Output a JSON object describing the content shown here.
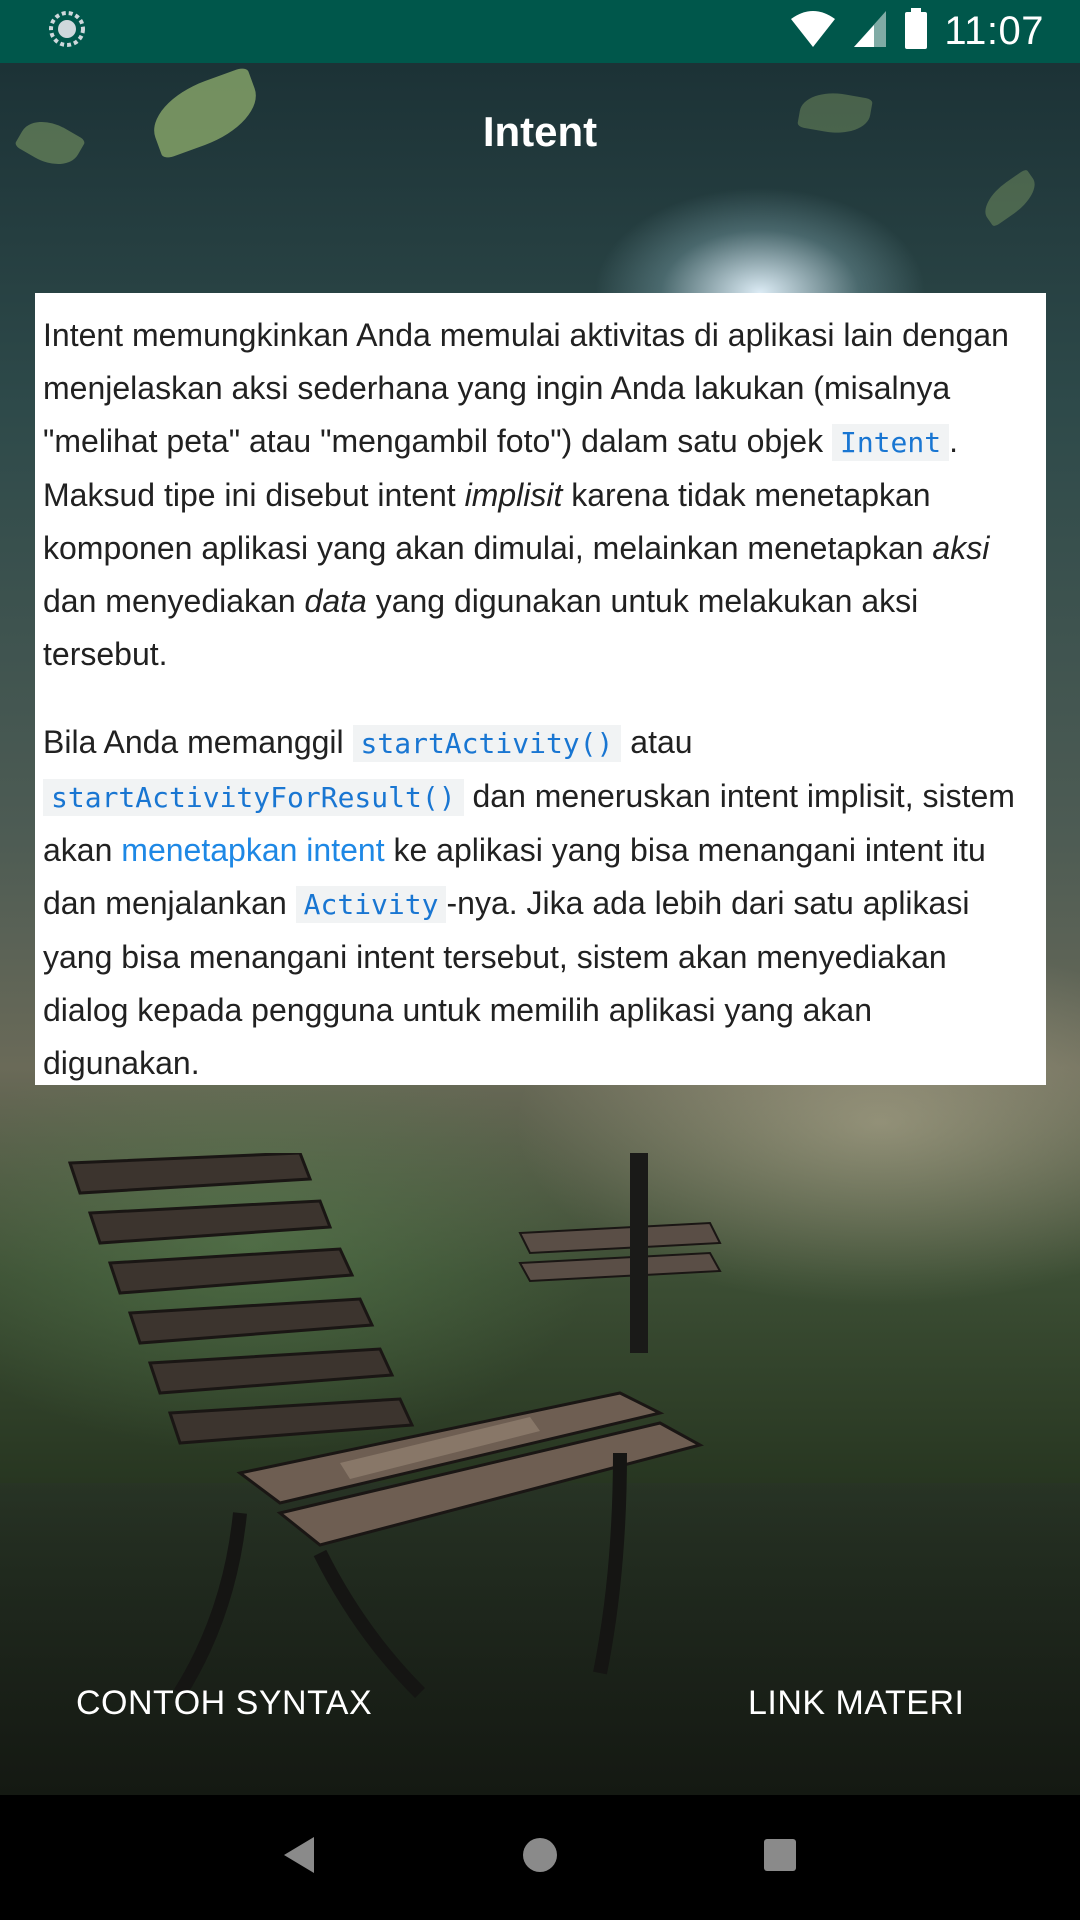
{
  "status_bar": {
    "time": "11:07",
    "icons": [
      "app-status-icon",
      "wifi-icon",
      "cellular-signal-icon",
      "battery-icon"
    ]
  },
  "app": {
    "title": "Intent"
  },
  "content": {
    "p1_part1": "Intent memungkinkan Anda memulai aktivitas di aplikasi lain dengan menjelaskan aksi sederhana yang ingin Anda lakukan (misalnya \"melihat peta\" atau \"mengambil foto\") dalam satu objek",
    "p1_code1": "Intent",
    "p1_part2": ". Maksud tipe ini disebut intent",
    "p1_em1": "implisit",
    "p1_part3": "karena tidak menetapkan komponen aplikasi yang akan dimulai, melainkan menetapkan",
    "p1_em2": "aksi",
    "p1_part4": "dan menyediakan",
    "p1_em3": "data",
    "p1_part5": "yang digunakan untuk melakukan aksi tersebut.",
    "p2_part1": "Bila Anda memanggil",
    "p2_code1": "startActivity()",
    "p2_part2": "atau",
    "p2_code2": "startActivityForResult()",
    "p2_part3": "dan meneruskan intent implisit, sistem akan",
    "p2_link": "menetapkan intent",
    "p2_part4": "ke aplikasi yang bisa menangani intent itu dan menjalankan",
    "p2_code3": "Activity",
    "p2_part5": "-nya. Jika ada lebih dari satu aplikasi yang bisa menangani intent tersebut, sistem akan menyediakan dialog kepada pengguna untuk memilih aplikasi yang akan digunakan."
  },
  "buttons": {
    "syntax_label": "CONTOH SYNTAX",
    "link_label": "LINK MATERI"
  },
  "nav_bar": {
    "icons": [
      "back-icon",
      "home-icon",
      "recents-icon"
    ]
  },
  "colors": {
    "status_bar": "#00574b",
    "code_text": "#1976d2",
    "link": "#1e88e5"
  }
}
